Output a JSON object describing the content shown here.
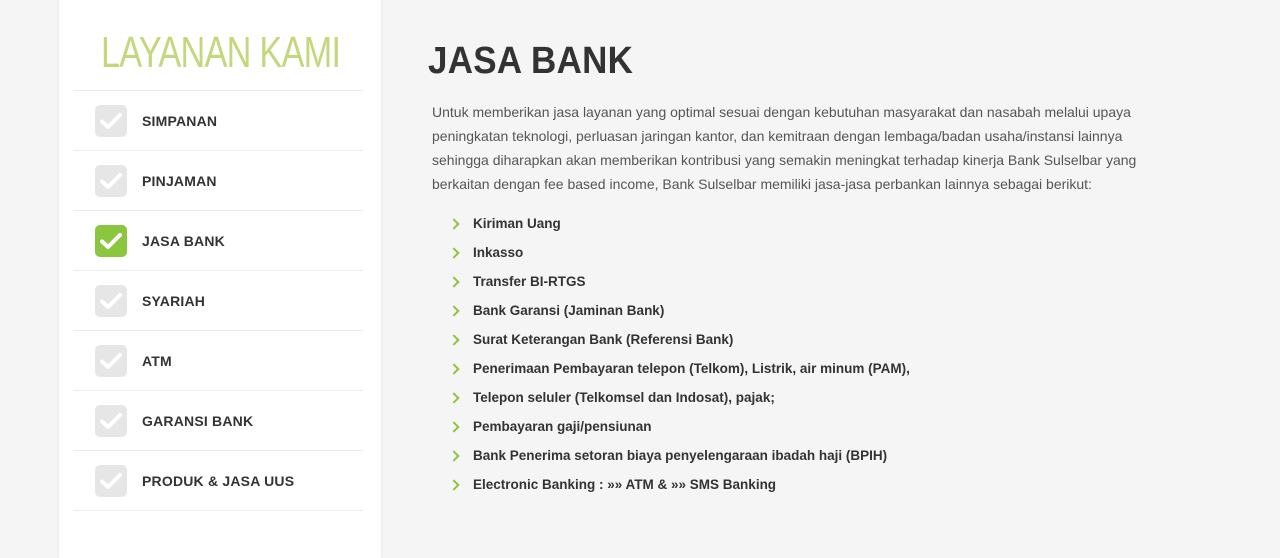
{
  "sidebar": {
    "title": "LAYANAN KAMI",
    "items": [
      {
        "label": "SIMPANAN",
        "active": false
      },
      {
        "label": "PINJAMAN",
        "active": false
      },
      {
        "label": "JASA BANK",
        "active": true
      },
      {
        "label": "SYARIAH",
        "active": false
      },
      {
        "label": "ATM",
        "active": false
      },
      {
        "label": "GARANSI BANK",
        "active": false
      },
      {
        "label": "PRODUK & JASA UUS",
        "active": false
      }
    ]
  },
  "main": {
    "title": "JASA BANK",
    "description": "Untuk memberikan jasa layanan yang optimal sesuai dengan kebutuhan masyarakat dan nasabah melalui upaya peningkatan teknologi, perluasan jaringan kantor, dan kemitraan dengan lembaga/badan usaha/instansi lainnya sehingga diharapkan akan memberikan kontribusi yang semakin meningkat terhadap kinerja Bank Sulselbar yang berkaitan dengan fee based income, Bank Sulselbar memiliki jasa-jasa perbankan lainnya sebagai berikut:",
    "services": [
      "Kiriman Uang",
      "Inkasso",
      "Transfer BI-RTGS",
      "Bank Garansi (Jaminan Bank)",
      "Surat Keterangan Bank (Referensi Bank)",
      "Penerimaan Pembayaran telepon (Telkom), Listrik, air minum (PAM),",
      "Telepon seluler (Telkomsel dan Indosat), pajak;",
      "Pembayaran gaji/pensiunan",
      "Bank Penerima setoran biaya penyelengaraan ibadah haji (BPIH)",
      "Electronic Banking : »» ATM & »» SMS Banking"
    ]
  },
  "colors": {
    "accent": "#8cc63f",
    "title_green": "#c5d77c",
    "inactive_check": "#e6e6e6"
  },
  "icons": {
    "menu_check": "check-icon",
    "service_bullet": "chevron-right-icon"
  }
}
